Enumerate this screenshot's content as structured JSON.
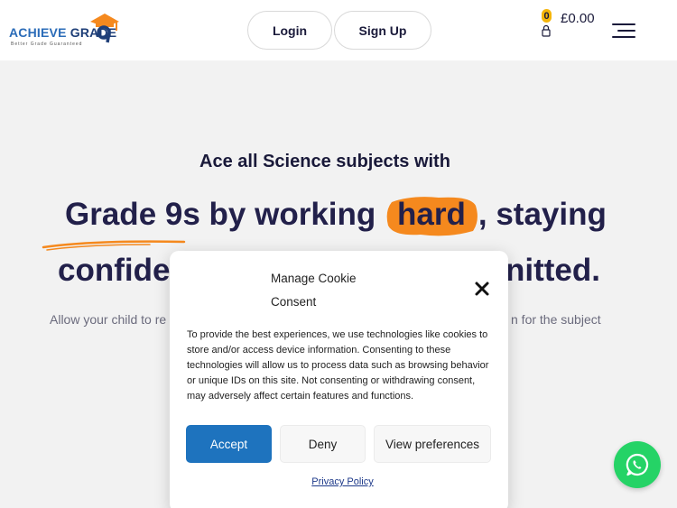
{
  "header": {
    "logo": {
      "text_a": "ACHIEVE",
      "text_b": "GRADE",
      "tagline": "Better Grade Guaranteed"
    },
    "login_label": "Login",
    "signup_label": "Sign Up",
    "cart": {
      "count": "0",
      "total": "£0.00"
    }
  },
  "hero": {
    "subtitle": "Ace all Science subjects with",
    "line1_before": "Grade 9s by working",
    "line1_highlight": "hard",
    "line1_after": ", staying",
    "line2_left": "confider",
    "line2_right": "nitted.",
    "para_left": "Allow your child to re",
    "para_right": "n for the subject"
  },
  "cookie_modal": {
    "title": "Manage Cookie Consent",
    "body": "To provide the best experiences, we use technologies like cookies to store and/or access device information. Consenting to these technologies will allow us to process data such as browsing behavior or unique IDs on this site. Not consenting or withdrawing consent, may adversely affect certain features and functions.",
    "accept_label": "Accept",
    "deny_label": "Deny",
    "preferences_label": "View preferences",
    "privacy_label": "Privacy Policy"
  },
  "colors": {
    "accent_orange": "#f5891e",
    "accept_blue": "#1e73be",
    "whatsapp_green": "#25d366",
    "heading_navy": "#22204a"
  },
  "icons": [
    "graduation-cap-icon",
    "lock-icon",
    "menu-icon",
    "close-icon",
    "whatsapp-icon"
  ]
}
